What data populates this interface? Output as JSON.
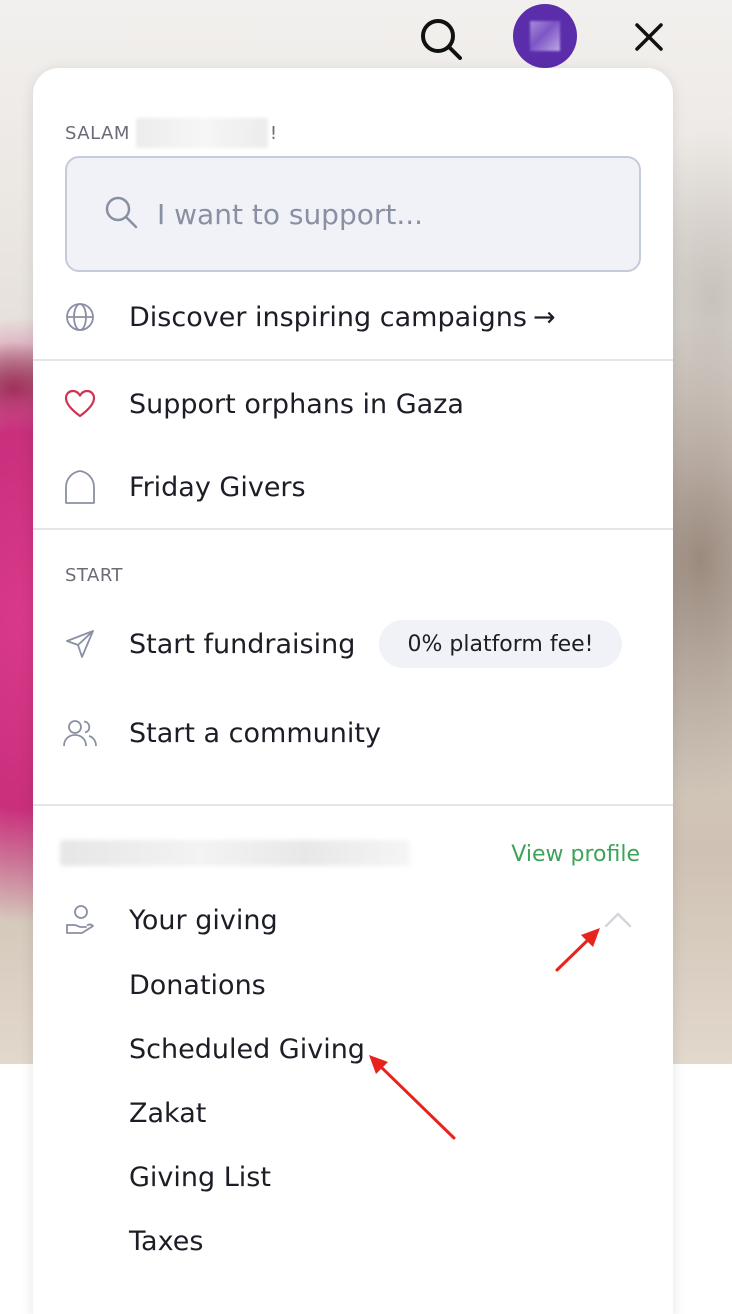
{
  "header": {
    "search_icon": "search-icon",
    "avatar": "avatar",
    "close_icon": "close-icon",
    "avatar_color": "#5b2dab"
  },
  "greeting": {
    "prefix": "SALAM",
    "suffix": "!"
  },
  "search": {
    "placeholder": "I want to support..."
  },
  "discover": {
    "label": "Discover inspiring campaigns",
    "arrow": "→",
    "icon": "globe-icon"
  },
  "favorites": [
    {
      "label": "Support orphans in Gaza",
      "icon": "heart-icon"
    },
    {
      "label": "Friday Givers",
      "icon": "arch-icon"
    }
  ],
  "start_section": {
    "title": "START",
    "fundraising_label": "Start fundraising",
    "fundraising_badge": "0% platform fee!",
    "community_label": "Start a community"
  },
  "account": {
    "view_profile": "View profile",
    "your_giving": "Your giving",
    "giving_items": [
      "Donations",
      "Scheduled Giving",
      "Zakat",
      "Giving List",
      "Taxes"
    ]
  },
  "colors": {
    "accent_green": "#3ea35a",
    "heart_red": "#d0314f",
    "annotation_arrow": "#e8231d"
  }
}
